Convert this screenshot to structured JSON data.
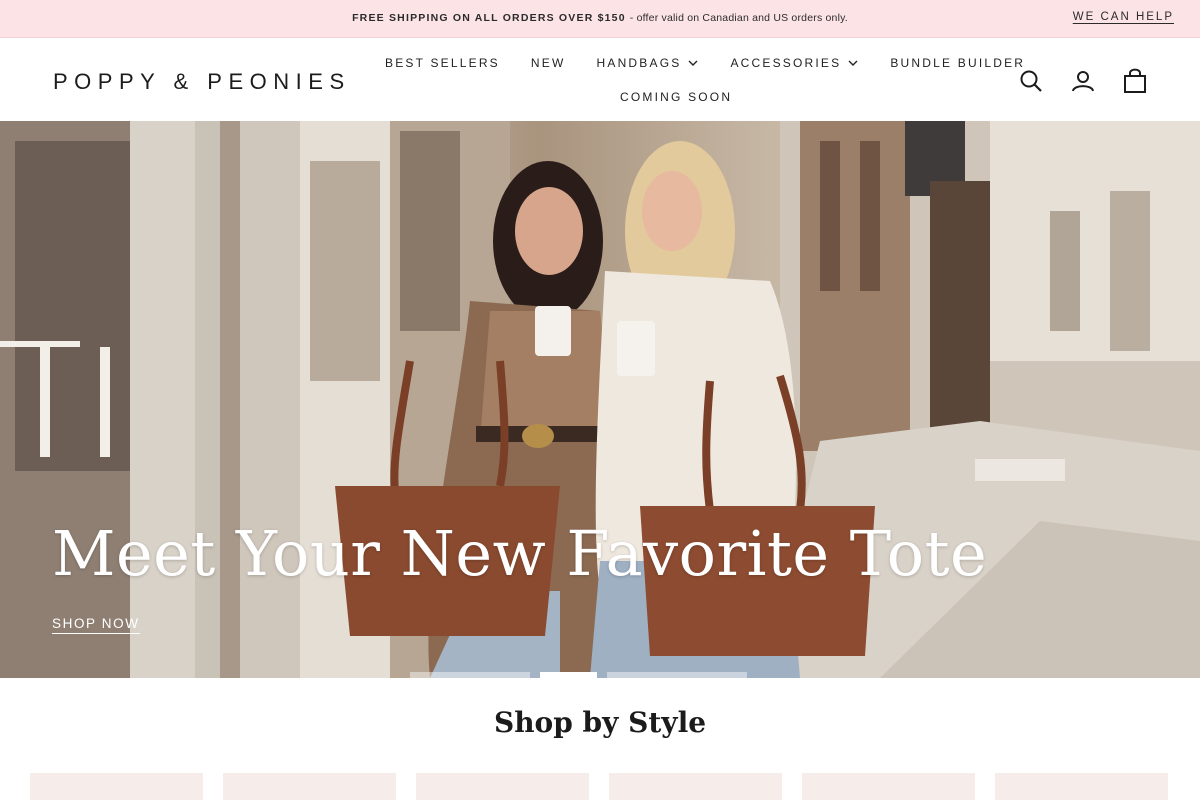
{
  "announcement": {
    "bold": "FREE SHIPPING ON ALL ORDERS OVER $150",
    "rest": "- offer valid on Canadian and US orders only.",
    "help_link": "WE CAN HELP"
  },
  "header": {
    "logo": "POPPY & PEONIES",
    "nav": [
      {
        "label": "BEST SELLERS",
        "has_dropdown": false
      },
      {
        "label": "NEW",
        "has_dropdown": false
      },
      {
        "label": "HANDBAGS",
        "has_dropdown": true
      },
      {
        "label": "ACCESSORIES",
        "has_dropdown": true
      },
      {
        "label": "BUNDLE BUILDER",
        "has_dropdown": false
      },
      {
        "label": "COMING SOON",
        "has_dropdown": false
      }
    ],
    "icons": [
      "search-icon",
      "account-icon",
      "cart-icon"
    ]
  },
  "hero": {
    "title": "Meet Your New Favorite Tote",
    "cta": "SHOP NOW",
    "slides": 3,
    "active_slide": 2
  },
  "shop_by_style": {
    "title": "Shop by Style",
    "card_count": 6
  },
  "colors": {
    "announcement_bg": "#fce3e6",
    "card_bg": "#f6ecea",
    "text": "#222222"
  }
}
